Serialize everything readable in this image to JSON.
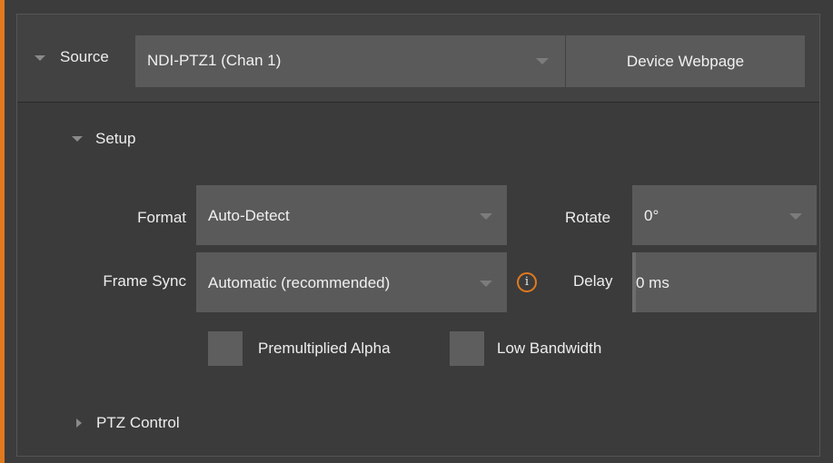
{
  "source": {
    "label": "Source",
    "selected": "NDI-PTZ1 (Chan 1)",
    "device_button": "Device Webpage"
  },
  "setup": {
    "header": "Setup",
    "format": {
      "label": "Format",
      "value": "Auto-Detect"
    },
    "rotate": {
      "label": "Rotate",
      "value": "0°"
    },
    "frame_sync": {
      "label": "Frame Sync",
      "value": "Automatic (recommended)"
    },
    "info_icon_glyph": "i",
    "delay": {
      "label": "Delay",
      "value": "0 ms"
    },
    "premultiplied_alpha": {
      "label": "Premultiplied Alpha",
      "checked": false
    },
    "low_bandwidth": {
      "label": "Low Bandwidth",
      "checked": false
    }
  },
  "ptz": {
    "header": "PTZ Control"
  },
  "colors": {
    "accent": "#e07a1f",
    "control_bg": "#5a5a5a",
    "panel_bg": "#3b3b3b"
  }
}
